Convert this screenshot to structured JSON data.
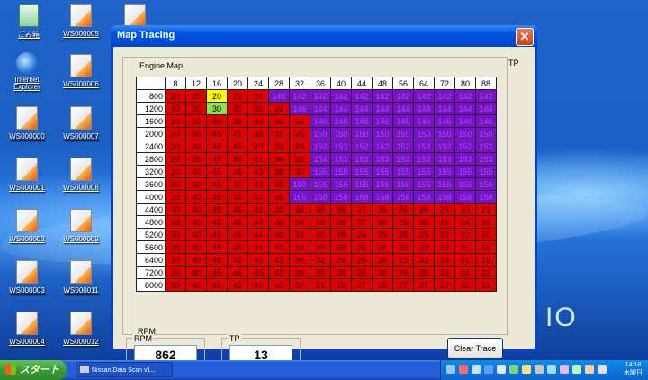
{
  "desktop": {
    "icons": [
      {
        "label": "ごみ箱",
        "type": "bin"
      },
      {
        "label": "WS000005",
        "type": "file"
      },
      {
        "label": "",
        "type": "file"
      },
      {
        "label": "Internet Explorer",
        "type": "ie"
      },
      {
        "label": "WS000006",
        "type": "file"
      },
      {
        "label": "WS000000",
        "type": "file"
      },
      {
        "label": "WS000007",
        "type": "file"
      },
      {
        "label": "WS000001",
        "type": "file"
      },
      {
        "label": "WS000008",
        "type": "file"
      },
      {
        "label": "WS000002",
        "type": "file"
      },
      {
        "label": "WS000009",
        "type": "file"
      },
      {
        "label": "WS000003",
        "type": "file"
      },
      {
        "label": "WS000011",
        "type": "file"
      },
      {
        "label": "WS000004",
        "type": "file"
      },
      {
        "label": "WS000012",
        "type": "file"
      }
    ],
    "wallpaper_text": "IO"
  },
  "window": {
    "title": "Map Tracing",
    "close_glyph": "✕",
    "tp_axis_label": "TP",
    "group_label": "Engine Map",
    "rpm_axis_label": "RPM",
    "tp_headers": [
      "8",
      "12",
      "16",
      "20",
      "24",
      "28",
      "32",
      "36",
      "40",
      "44",
      "48",
      "56",
      "64",
      "72",
      "80",
      "88"
    ],
    "rows": [
      {
        "rpm": "800",
        "values": [
          "20",
          "20",
          "20",
          "20",
          "20",
          "146",
          "142",
          "142",
          "142",
          "142",
          "142",
          "142",
          "142",
          "142",
          "142",
          "142"
        ],
        "colors": [
          "r",
          "r",
          "y",
          "r",
          "r",
          "p",
          "p",
          "p",
          "p",
          "p",
          "p",
          "p",
          "p",
          "p",
          "p",
          "p"
        ]
      },
      {
        "rpm": "1200",
        "values": [
          "20",
          "25",
          "30",
          "30",
          "30",
          "24",
          "146",
          "144",
          "144",
          "144",
          "144",
          "144",
          "144",
          "144",
          "144",
          "144"
        ],
        "colors": [
          "r",
          "r",
          "g",
          "r",
          "r",
          "r",
          "p",
          "p",
          "p",
          "p",
          "p",
          "p",
          "p",
          "p",
          "p",
          "p"
        ]
      },
      {
        "rpm": "1600",
        "values": [
          "20",
          "30",
          "40",
          "39",
          "36",
          "30",
          "24",
          "146",
          "146",
          "146",
          "146",
          "146",
          "146",
          "146",
          "146",
          "146"
        ],
        "colors": [
          "r",
          "r",
          "r",
          "r",
          "r",
          "r",
          "r",
          "p",
          "p",
          "p",
          "p",
          "p",
          "p",
          "p",
          "p",
          "p"
        ]
      },
      {
        "rpm": "2000",
        "values": [
          "20",
          "30",
          "45",
          "41",
          "38",
          "32",
          "26",
          "150",
          "150",
          "150",
          "150",
          "150",
          "150",
          "150",
          "150",
          "150"
        ],
        "colors": [
          "r",
          "r",
          "r",
          "r",
          "r",
          "r",
          "r",
          "p",
          "p",
          "p",
          "p",
          "p",
          "p",
          "p",
          "p",
          "p"
        ]
      },
      {
        "rpm": "2400",
        "values": [
          "20",
          "30",
          "45",
          "45",
          "40",
          "34",
          "28",
          "152",
          "152",
          "152",
          "152",
          "152",
          "152",
          "152",
          "152",
          "152"
        ],
        "colors": [
          "r",
          "r",
          "r",
          "r",
          "r",
          "r",
          "r",
          "p",
          "p",
          "p",
          "p",
          "p",
          "p",
          "p",
          "p",
          "p"
        ]
      },
      {
        "rpm": "2800",
        "values": [
          "20",
          "35",
          "45",
          "45",
          "41",
          "36",
          "30",
          "154",
          "153",
          "153",
          "153",
          "153",
          "153",
          "153",
          "153",
          "153"
        ],
        "colors": [
          "r",
          "r",
          "r",
          "r",
          "r",
          "r",
          "r",
          "p",
          "p",
          "p",
          "p",
          "p",
          "p",
          "p",
          "p",
          "p"
        ]
      },
      {
        "rpm": "3200",
        "values": [
          "20",
          "40",
          "45",
          "45",
          "43",
          "38",
          "32",
          "155",
          "155",
          "155",
          "155",
          "155",
          "155",
          "155",
          "155",
          "155"
        ],
        "colors": [
          "r",
          "r",
          "r",
          "r",
          "r",
          "r",
          "r",
          "p",
          "p",
          "p",
          "p",
          "p",
          "p",
          "p",
          "p",
          "p"
        ]
      },
      {
        "rpm": "3600",
        "values": [
          "30",
          "40",
          "45",
          "45",
          "43",
          "38",
          "160",
          "156",
          "156",
          "156",
          "156",
          "156",
          "156",
          "156",
          "156",
          "156"
        ],
        "colors": [
          "r",
          "r",
          "r",
          "r",
          "r",
          "r",
          "p",
          "p",
          "p",
          "p",
          "p",
          "p",
          "p",
          "p",
          "p",
          "p"
        ]
      },
      {
        "rpm": "4000",
        "values": [
          "30",
          "40",
          "45",
          "45",
          "44",
          "38",
          "160",
          "158",
          "158",
          "158",
          "158",
          "158",
          "158",
          "158",
          "158",
          "158"
        ],
        "colors": [
          "r",
          "r",
          "r",
          "r",
          "r",
          "r",
          "p",
          "p",
          "p",
          "p",
          "p",
          "p",
          "p",
          "p",
          "p",
          "p"
        ]
      },
      {
        "rpm": "4400",
        "values": [
          "30",
          "40",
          "45",
          "45",
          "44",
          "40",
          "34",
          "30",
          "28",
          "27",
          "26",
          "26",
          "26",
          "25",
          "23",
          "21"
        ],
        "colors": [
          "r",
          "r",
          "r",
          "r",
          "r",
          "r",
          "r",
          "r",
          "r",
          "r",
          "r",
          "r",
          "r",
          "r",
          "r",
          "r"
        ]
      },
      {
        "rpm": "4800",
        "values": [
          "30",
          "40",
          "45",
          "45",
          "44",
          "40",
          "34",
          "30",
          "28",
          "27",
          "26",
          "26",
          "26",
          "26",
          "24",
          "22"
        ],
        "colors": [
          "r",
          "r",
          "r",
          "r",
          "r",
          "r",
          "r",
          "r",
          "r",
          "r",
          "r",
          "r",
          "r",
          "r",
          "r",
          "r"
        ]
      },
      {
        "rpm": "5200",
        "values": [
          "30",
          "40",
          "45",
          "45",
          "44",
          "40",
          "34",
          "30",
          "28",
          "26",
          "25",
          "25",
          "25",
          "23",
          "22",
          "20"
        ],
        "colors": [
          "r",
          "r",
          "r",
          "r",
          "r",
          "r",
          "r",
          "r",
          "r",
          "r",
          "r",
          "r",
          "r",
          "r",
          "r",
          "r"
        ]
      },
      {
        "rpm": "5600",
        "values": [
          "30",
          "40",
          "45",
          "45",
          "44",
          "40",
          "34",
          "30",
          "28",
          "26",
          "24",
          "23",
          "23",
          "23",
          "21",
          "19"
        ],
        "colors": [
          "r",
          "r",
          "r",
          "r",
          "r",
          "r",
          "r",
          "r",
          "r",
          "r",
          "r",
          "r",
          "r",
          "r",
          "r",
          "r"
        ]
      },
      {
        "rpm": "6400",
        "values": [
          "30",
          "40",
          "45",
          "45",
          "46",
          "42",
          "36",
          "32",
          "29",
          "26",
          "24",
          "23",
          "23",
          "23",
          "21",
          "19"
        ],
        "colors": [
          "r",
          "r",
          "r",
          "r",
          "r",
          "r",
          "r",
          "r",
          "r",
          "r",
          "r",
          "r",
          "r",
          "r",
          "r",
          "r"
        ]
      },
      {
        "rpm": "7200",
        "values": [
          "30",
          "40",
          "45",
          "45",
          "45",
          "42",
          "36",
          "30",
          "28",
          "26",
          "26",
          "26",
          "26",
          "26",
          "24",
          "22"
        ],
        "colors": [
          "r",
          "r",
          "r",
          "r",
          "r",
          "r",
          "r",
          "r",
          "r",
          "r",
          "r",
          "r",
          "r",
          "r",
          "r",
          "r"
        ]
      },
      {
        "rpm": "8000",
        "values": [
          "30",
          "40",
          "45",
          "45",
          "46",
          "43",
          "37",
          "31",
          "29",
          "27",
          "26",
          "27",
          "27",
          "27",
          "25",
          "23"
        ],
        "colors": [
          "r",
          "r",
          "r",
          "r",
          "r",
          "r",
          "r",
          "r",
          "r",
          "r",
          "r",
          "r",
          "r",
          "r",
          "r",
          "r"
        ]
      }
    ],
    "rpm_label": "RPM",
    "rpm_value": "862",
    "tp_label": "TP",
    "tp_value": "13",
    "clear_button": "Clear Trace"
  },
  "taskbar": {
    "start_label": "スタート",
    "task_label": "Nissan Data Scan v1...",
    "clock_time": "14:18",
    "clock_day": "木曜日"
  }
}
